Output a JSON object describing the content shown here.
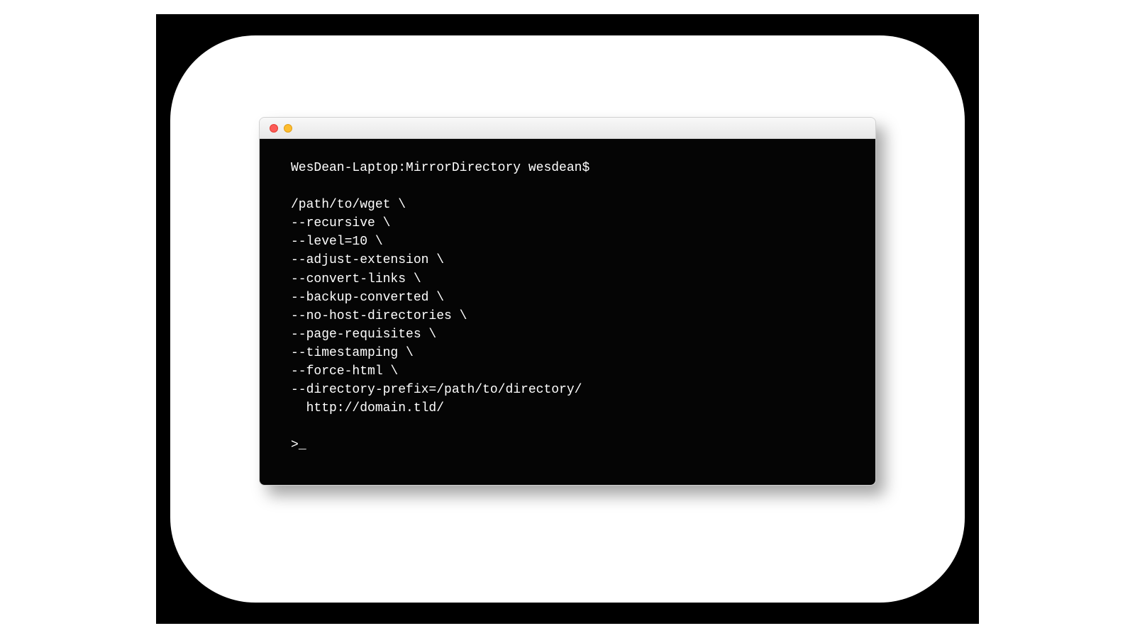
{
  "terminal": {
    "prompt": "WesDean-Laptop:MirrorDirectory wesdean$",
    "lines": [
      "/path/to/wget \\",
      "--recursive \\",
      "--level=10 \\",
      "--adjust-extension \\",
      "--convert-links \\",
      "--backup-converted \\",
      "--no-host-directories \\",
      "--page-requisites \\",
      "--timestamping \\",
      "--force-html \\",
      "--directory-prefix=/path/to/directory/",
      "  http://domain.tld/"
    ],
    "nextPrompt": ">",
    "cursor": "_"
  }
}
